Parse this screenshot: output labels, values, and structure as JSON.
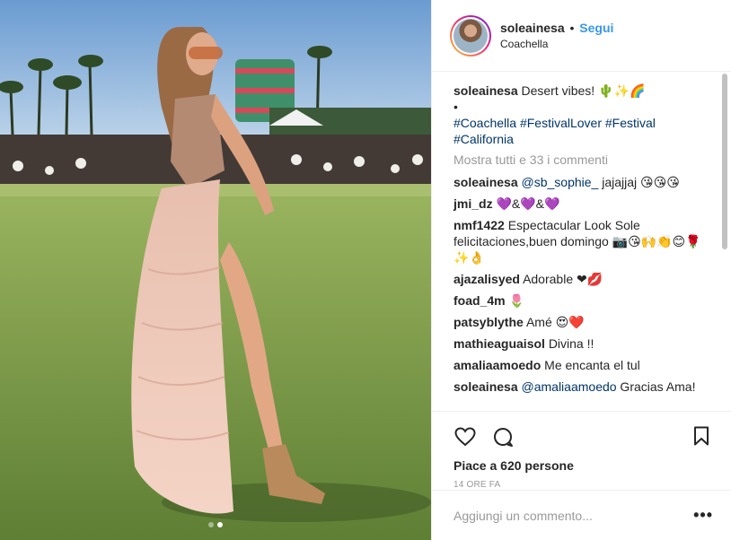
{
  "post": {
    "username": "soleainesa",
    "separator": "•",
    "follow_label": "Segui",
    "location": "Coachella",
    "image_alt": "Woman in pink tulle skirt at festival field",
    "carousel_dots": 2
  },
  "caption": {
    "username": "soleainesa",
    "text": "Desert vibes! 🌵✨🌈",
    "bullet": "•",
    "hashtags": [
      "#Coachella",
      "#FestivalLover",
      "#Festival",
      "#California"
    ]
  },
  "view_all_comments": "Mostra tutti e 33 i commenti",
  "comments": [
    {
      "user": "soleainesa",
      "mention": "@sb_sophie_",
      "text": " jajajjaj 😘😘😘"
    },
    {
      "user": "jmi_dz",
      "mention": "",
      "text": "💜&💜&💜"
    },
    {
      "user": "nmf1422",
      "mention": "",
      "text": "Espectacular Look Sole felicitaciones,buen domingo 📷😘🙌👏😊🌹✨👌"
    },
    {
      "user": "ajazalisyed",
      "mention": "",
      "text": "Adorable ❤💋"
    },
    {
      "user": "foad_4m",
      "mention": "",
      "text": "🌷"
    },
    {
      "user": "patsyblythe",
      "mention": "",
      "text": "Amé 😍❤️"
    },
    {
      "user": "mathieaguaisol",
      "mention": "",
      "text": "Divina !!"
    },
    {
      "user": "amaliaamoedo",
      "mention": "",
      "text": "Me encanta el tul"
    },
    {
      "user": "soleainesa",
      "mention": "@amaliaamoedo",
      "text": " Gracias Ama!"
    }
  ],
  "likes": "Piace a 620 persone",
  "timestamp": "14 ORE FA",
  "add_comment_placeholder": "Aggiungi un commento...",
  "more_options": "•••",
  "colors": {
    "follow": "#3897f0",
    "hashtag": "#003569",
    "muted": "#999999",
    "border": "#efefef"
  },
  "icons": {
    "like": "heart-icon",
    "comment": "comment-icon",
    "save": "bookmark-icon"
  }
}
